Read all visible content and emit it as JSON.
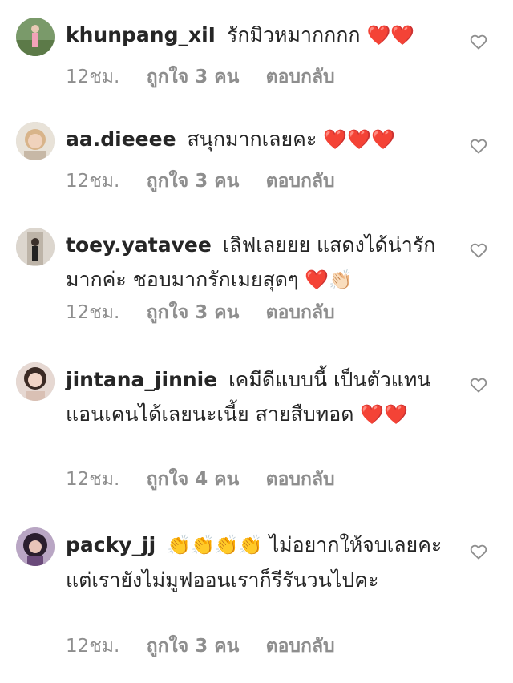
{
  "comments": [
    {
      "username": "khunpang_xiI",
      "text": "รักมิวหมากกกก",
      "emoji": "❤️❤️",
      "time": "12ชม.",
      "likes": "ถูกใจ 3 คน",
      "reply": "ตอบกลับ"
    },
    {
      "username": "aa.dieeee",
      "text": "สนุกมากเลยคะ",
      "emoji": "❤️❤️❤️",
      "time": "12ชม.",
      "likes": "ถูกใจ 3 คน",
      "reply": "ตอบกลับ"
    },
    {
      "username": "toey.yatavee",
      "text": "เลิฟเลยยย แสดงได้น่ารักมากค่ะ ชอบมากรักเมยสุดๆ",
      "emoji": "❤️👏🏻",
      "time": "12ชม.",
      "likes": "ถูกใจ 3 คน",
      "reply": "ตอบกลับ"
    },
    {
      "username": "jintana_jinnie",
      "text": "เคมีดีแบบนี้ เป็นตัวแทน แอนเคนได้เลยนะเนี้ย สายสืบทอด",
      "emoji": "❤️❤️",
      "time": "12ชม.",
      "likes": "ถูกใจ 4 คน",
      "reply": "ตอบกลับ"
    },
    {
      "username": "packy_jj",
      "text": "ไม่อยากให้จบเลยคะ แต่เรายังไม่มูฟออนเราก็รีรันวนไปคะ",
      "emoji": "👏👏👏👏",
      "time": "12ชม.",
      "likes": "ถูกใจ 3 คน",
      "reply": "ตอบกลับ"
    }
  ],
  "colors": {
    "text": "#262626",
    "meta": "#8e8e8e",
    "heart_outline": "#8e8e8e",
    "emoji_heart": "#e0321f"
  },
  "icons": {
    "like": "heart-outline-icon"
  }
}
